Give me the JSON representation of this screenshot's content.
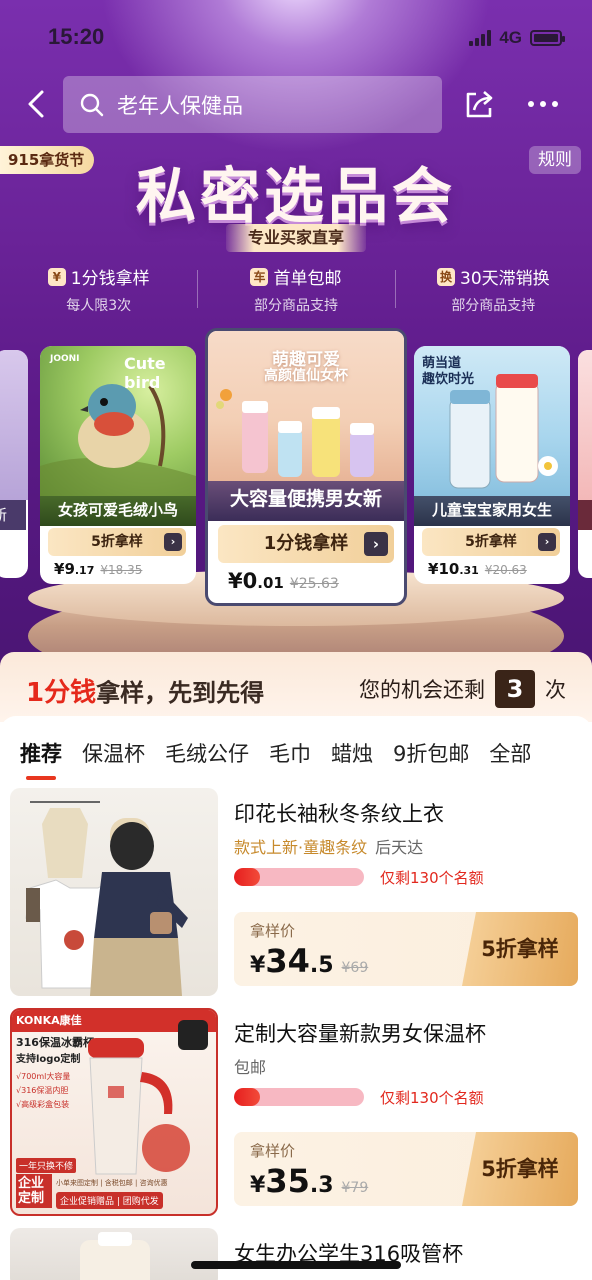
{
  "status": {
    "time": "15:20",
    "network": "4G"
  },
  "header": {
    "search_placeholder": "老年人保健品"
  },
  "hero": {
    "festival_badge": "915拿货节",
    "rules": "规则",
    "title": "私密选品会",
    "subtitle": "专业买家直享",
    "benefits": [
      {
        "icon_text": "¥",
        "title": "1分钱拿样",
        "sub": "每人限3次"
      },
      {
        "icon_text": "车",
        "title": "首单包邮",
        "sub": "部分商品支持"
      },
      {
        "icon_text": "换",
        "title": "30天滞销换",
        "sub": "部分商品支持"
      }
    ]
  },
  "carousel": {
    "left": {
      "brand": "JOONI",
      "overlay": "Cute bird",
      "name": "女孩可爱毛绒小鸟",
      "cta": "5折拿样",
      "price_int": "9",
      "price_dec": ".17",
      "old_price": "¥18.35"
    },
    "center": {
      "overlay_line1": "萌趣可爱",
      "overlay_line2": "高颜值仙女杯",
      "name": "大容量便携男女新",
      "cta": "1分钱拿样",
      "price_int": "0",
      "price_dec": ".01",
      "old_price": "¥25.63"
    },
    "right": {
      "overlay_line1": "萌当道",
      "overlay_line2": "趣饮时光",
      "name": "儿童宝宝家用女生",
      "cta": "5折拿样",
      "price_int": "10",
      "price_dec": ".31",
      "old_price": "¥20.63"
    },
    "left_edge_text": "新"
  },
  "promo": {
    "highlight": "1分钱",
    "text": "拿样，先到先得",
    "chance_label": "您的机会还剩",
    "count": "3",
    "unit": "次"
  },
  "tabs": [
    "推荐",
    "保温杯",
    "毛绒公仔",
    "毛巾",
    "蜡烛",
    "9折包邮",
    "全部"
  ],
  "products": [
    {
      "title": "印花长袖秋冬条纹上衣",
      "tag": "款式上新·童趣条纹",
      "brand": "后天达",
      "progress": 0.2,
      "remain": "仅剩130个名额",
      "price_label": "拿样价",
      "price_int": "34",
      "price_dec": ".5",
      "old_price": "¥69",
      "button": "5折拿样"
    },
    {
      "title": "定制大容量新款男女保温杯",
      "tag": "包邮",
      "brand": "",
      "progress": 0.2,
      "remain": "仅剩130个名额",
      "price_label": "拿样价",
      "price_int": "35",
      "price_dec": ".3",
      "old_price": "¥79",
      "button": "5折拿样",
      "thumb": {
        "brand": "KONKA康佳",
        "line1": "316保温冰霸杯",
        "line2": "支持logo定制",
        "features": [
          "√700ml大容量",
          "√316保温内胆",
          "√高级彩盒包装"
        ],
        "badge": "一年只换不修",
        "corner": "企业定制",
        "footer1": "小单来图定制 | 含税包邮 | 咨询优惠",
        "footer2": "企业促销赠品 | 团购代发"
      }
    },
    {
      "title": "女生办公学生316吸管杯"
    }
  ]
}
